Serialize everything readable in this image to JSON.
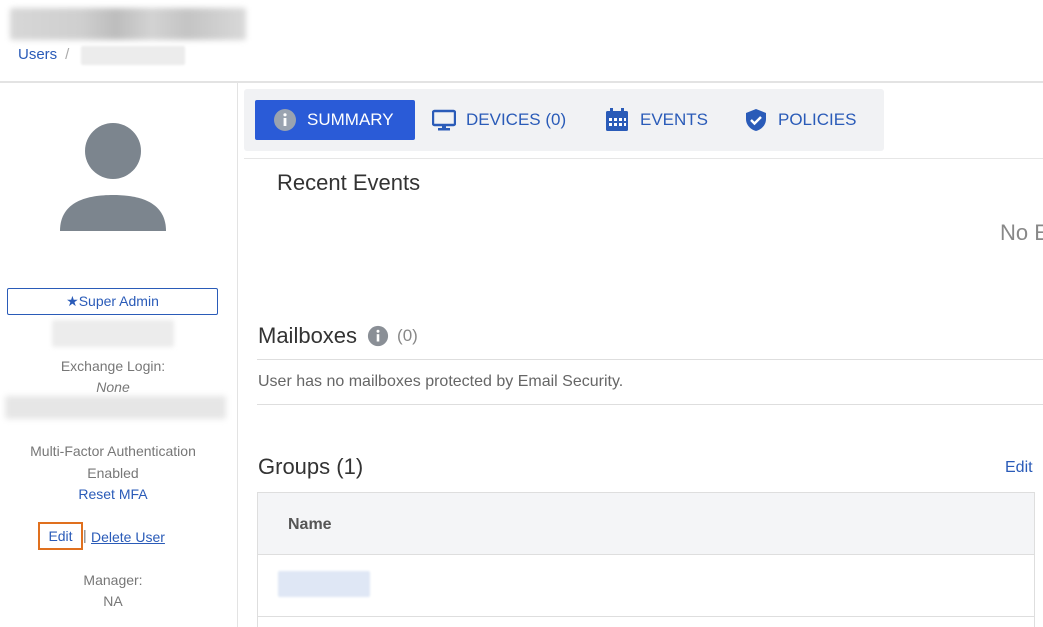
{
  "header": {
    "breadcrumb": {
      "root": "Users",
      "separator": "/"
    }
  },
  "sidebar": {
    "role_badge": "★Super Admin",
    "exchange_login_label": "Exchange Login:",
    "exchange_login_value": "None",
    "mfa_label": "Multi-Factor Authentication",
    "mfa_status": "Enabled",
    "reset_mfa": "Reset MFA",
    "edit": "Edit",
    "pipe": "|",
    "delete_user": "Delete User",
    "manager_label": "Manager:",
    "manager_value": "NA"
  },
  "tabs": [
    {
      "label": "SUMMARY",
      "icon": "info-icon",
      "active": true
    },
    {
      "label": "DEVICES (0)",
      "icon": "monitor-icon",
      "active": false
    },
    {
      "label": "EVENTS",
      "icon": "calendar-icon",
      "active": false
    },
    {
      "label": "POLICIES",
      "icon": "shield-check-icon",
      "active": false
    }
  ],
  "recent_events": {
    "title": "Recent Events",
    "empty_text": "No E"
  },
  "mailboxes": {
    "title": "Mailboxes",
    "count": "(0)",
    "message": "User has no mailboxes protected by Email Security."
  },
  "groups": {
    "title": "Groups (1)",
    "edit": "Edit",
    "columns": [
      "Name"
    ]
  },
  "colors": {
    "accent": "#2a5bd7",
    "link": "#2a5bb8",
    "highlight": "#e0701e"
  }
}
